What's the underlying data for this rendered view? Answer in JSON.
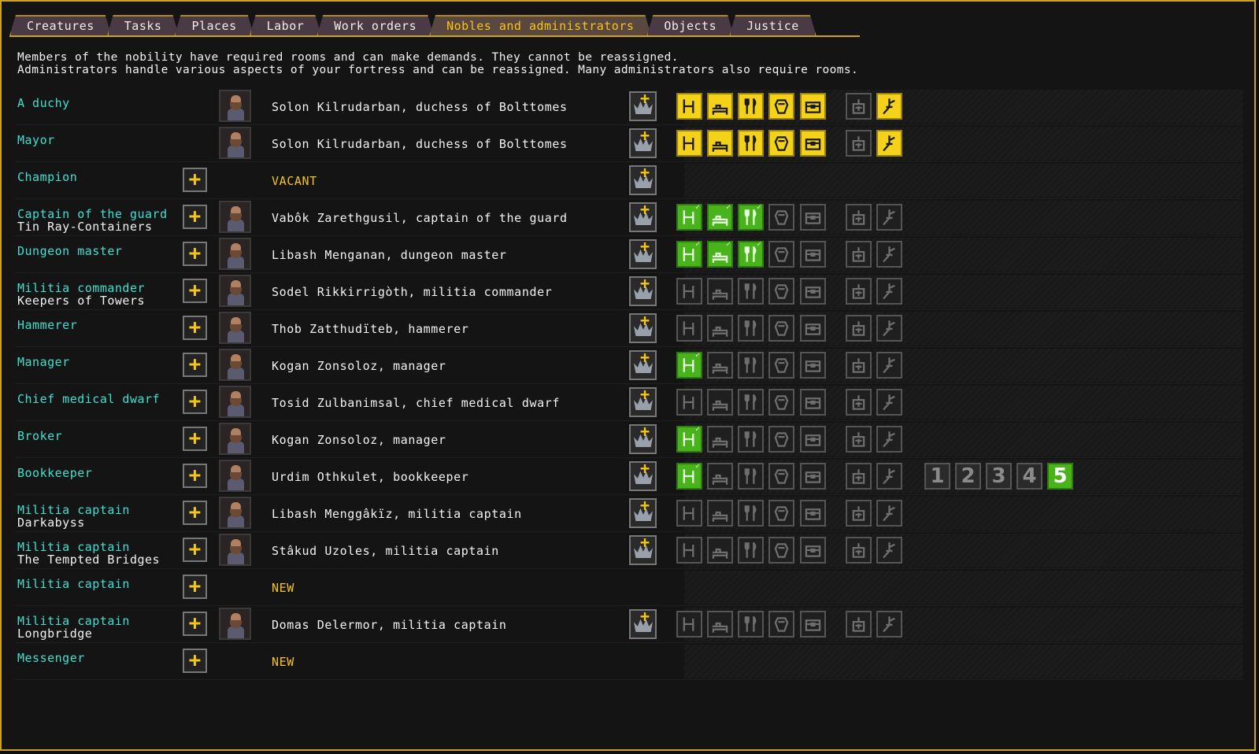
{
  "tabs": [
    "Creatures",
    "Tasks",
    "Places",
    "Labor",
    "Work orders",
    "Nobles and administrators",
    "Objects",
    "Justice"
  ],
  "active_tab": 5,
  "description": [
    "Members of the nobility have required rooms and can make demands. They cannot be reassigned.",
    "Administrators handle various aspects of your fortress and can be reassigned. Many administrators also require rooms."
  ],
  "requirement_icons": [
    "office-icon",
    "bedroom-icon",
    "dining-icon",
    "tomb-icon",
    "chest-icon",
    "cabinet-icon",
    "hammer-icon"
  ],
  "colors": {
    "met_yellow": "#f5d21a",
    "met_green": "#48b31a",
    "cyan": "#3fe0d0",
    "gold": "#f5c518"
  },
  "rows": [
    {
      "position": "A duchy",
      "sub": "",
      "plus": false,
      "portrait": true,
      "name": "Solon Kilrudarban, duchess of Bolttomes",
      "crown": true,
      "req": [
        "yellow",
        "yellow",
        "yellow",
        "yellow",
        "yellow",
        "gray",
        "yellow"
      ]
    },
    {
      "position": "Mayor",
      "sub": "",
      "plus": false,
      "portrait": true,
      "name": "Solon Kilrudarban, duchess of Bolttomes",
      "crown": true,
      "req": [
        "yellow",
        "yellow",
        "yellow",
        "yellow",
        "yellow",
        "gray",
        "yellow"
      ]
    },
    {
      "position": "Champion",
      "sub": "",
      "plus": true,
      "portrait": false,
      "name": "VACANT",
      "crown": true,
      "req": []
    },
    {
      "position": "Captain of the guard",
      "sub": "Tin Ray-Containers",
      "plus": true,
      "portrait": true,
      "name": "Vabôk Zarethgusil, captain of the guard",
      "crown": true,
      "req": [
        "green",
        "green",
        "green",
        "gray",
        "gray",
        "gray",
        "gray"
      ]
    },
    {
      "position": "Dungeon master",
      "sub": "",
      "plus": true,
      "portrait": true,
      "name": "Libash Menganan, dungeon master",
      "crown": true,
      "req": [
        "green",
        "green",
        "green",
        "gray",
        "gray",
        "gray",
        "gray"
      ]
    },
    {
      "position": "Militia commander",
      "sub": "Keepers of Towers",
      "plus": true,
      "portrait": true,
      "name": "Sodel Rikkirrigòth, militia commander",
      "crown": true,
      "req": [
        "gray",
        "gray",
        "gray",
        "gray",
        "gray",
        "gray",
        "gray"
      ]
    },
    {
      "position": "Hammerer",
      "sub": "",
      "plus": true,
      "portrait": true,
      "name": "Thob Zatthudïteb, hammerer",
      "crown": true,
      "req": [
        "gray",
        "gray",
        "gray",
        "gray",
        "gray",
        "gray",
        "gray"
      ]
    },
    {
      "position": "Manager",
      "sub": "",
      "plus": true,
      "portrait": true,
      "name": "Kogan Zonsoloz, manager",
      "crown": true,
      "req": [
        "green",
        "gray",
        "gray",
        "gray",
        "gray",
        "gray",
        "gray"
      ]
    },
    {
      "position": "Chief medical dwarf",
      "sub": "",
      "plus": true,
      "portrait": true,
      "name": "Tosid Zulbanimsal, chief medical dwarf",
      "crown": true,
      "req": [
        "gray",
        "gray",
        "gray",
        "gray",
        "gray",
        "gray",
        "gray"
      ]
    },
    {
      "position": "Broker",
      "sub": "",
      "plus": true,
      "portrait": true,
      "name": "Kogan Zonsoloz, manager",
      "crown": true,
      "req": [
        "green",
        "gray",
        "gray",
        "gray",
        "gray",
        "gray",
        "gray"
      ]
    },
    {
      "position": "Bookkeeper",
      "sub": "",
      "plus": true,
      "portrait": true,
      "name": "Urdim Othkulet, bookkeeper",
      "crown": true,
      "req": [
        "green",
        "gray",
        "gray",
        "gray",
        "gray",
        "gray",
        "gray"
      ],
      "precision": {
        "levels": [
          "1",
          "2",
          "3",
          "4",
          "5"
        ],
        "selected": 5
      }
    },
    {
      "position": "Militia captain",
      "sub": "Darkabyss",
      "plus": true,
      "portrait": true,
      "name": "Libash Menggâkïz, militia captain",
      "crown": true,
      "req": [
        "gray",
        "gray",
        "gray",
        "gray",
        "gray",
        "gray",
        "gray"
      ]
    },
    {
      "position": "Militia captain",
      "sub": "The Tempted Bridges",
      "plus": true,
      "portrait": true,
      "name": "Stâkud Uzoles, militia captain",
      "crown": true,
      "req": [
        "gray",
        "gray",
        "gray",
        "gray",
        "gray",
        "gray",
        "gray"
      ]
    },
    {
      "position": "Militia captain",
      "sub": "",
      "plus": true,
      "portrait": false,
      "name": "NEW",
      "crown": false,
      "req": []
    },
    {
      "position": "Militia captain",
      "sub": "Longbridge",
      "plus": true,
      "portrait": true,
      "name": "Domas Delermor, militia captain",
      "crown": true,
      "req": [
        "gray",
        "gray",
        "gray",
        "gray",
        "gray",
        "gray",
        "gray"
      ]
    },
    {
      "position": "Messenger",
      "sub": "",
      "plus": true,
      "portrait": false,
      "name": "NEW",
      "crown": false,
      "req": []
    }
  ]
}
